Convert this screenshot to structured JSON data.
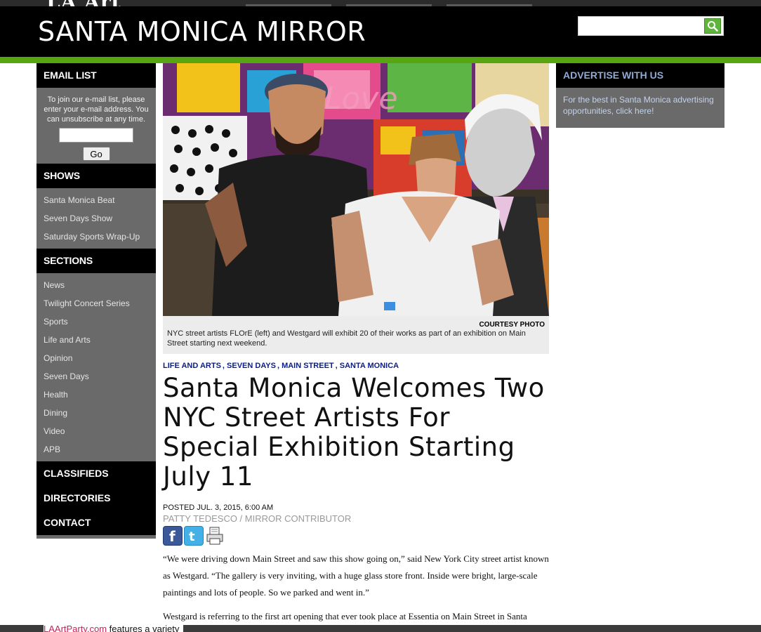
{
  "background": {
    "top_logo": "LA Art",
    "bottom_link": "LAArtParty.com",
    "bottom_text": " features a variety"
  },
  "header": {
    "site_title": "SANTA MONICA MIRROR",
    "search": {
      "placeholder": "",
      "value": "",
      "button_icon": "search-icon"
    }
  },
  "colors": {
    "accent_green": "#58a512",
    "header_bg": "#000000",
    "sidebar_gray": "#6a6a6a",
    "tag_blue": "#0a1d8c"
  },
  "sidebar_left": {
    "email": {
      "heading": "EMAIL LIST",
      "text": "To join our e-mail list, please enter your e-mail address. You can unsubscribe at any time.",
      "input_value": "",
      "button_label": "Go"
    },
    "shows": {
      "heading": "SHOWS",
      "items": [
        "Santa Monica Beat",
        "Seven Days Show",
        "Saturday Sports Wrap-Up"
      ]
    },
    "sections": {
      "heading": "SECTIONS",
      "items": [
        "News",
        "Twilight Concert Series",
        "Sports",
        "Life and Arts",
        "Opinion",
        "Seven Days",
        "Health",
        "Dining",
        "Video",
        "APB"
      ]
    },
    "footer_links": [
      "CLASSIFIEDS",
      "DIRECTORIES",
      "CONTACT"
    ]
  },
  "article": {
    "photo_credit": "COURTESY PHOTO",
    "caption": "NYC street artists FLOrE (left) and Westgard will exhibit 20 of their works as part of an exhibition on Main Street starting next weekend.",
    "tags": [
      "LIFE AND ARTS",
      "SEVEN DAYS",
      "MAIN STREET",
      "SANTA MONICA"
    ],
    "headline": "Santa Monica Welcomes Two NYC Street Artists For Special Exhibition Starting July 11",
    "posted": "POSTED JUL. 3, 2015, 6:00 AM",
    "author": "PATTY TEDESCO / MIRROR CONTRIBUTOR",
    "share_icons": [
      "facebook-icon",
      "twitter-icon",
      "print-icon"
    ],
    "paragraphs": [
      "“We were driving down Main Street and saw this show going on,” said New York City street artist known as Westgard. “The gallery is very inviting, with a huge glass store front. Inside were bright, large-scale paintings and lots of people. So we parked and went in.”",
      "Westgard is referring to the first art opening that ever took place at Essentia on Main Street in Santa"
    ]
  },
  "sidebar_right": {
    "heading": "ADVERTISE WITH US",
    "text": "For the best in Santa Monica advertising opportunities, click here!"
  }
}
